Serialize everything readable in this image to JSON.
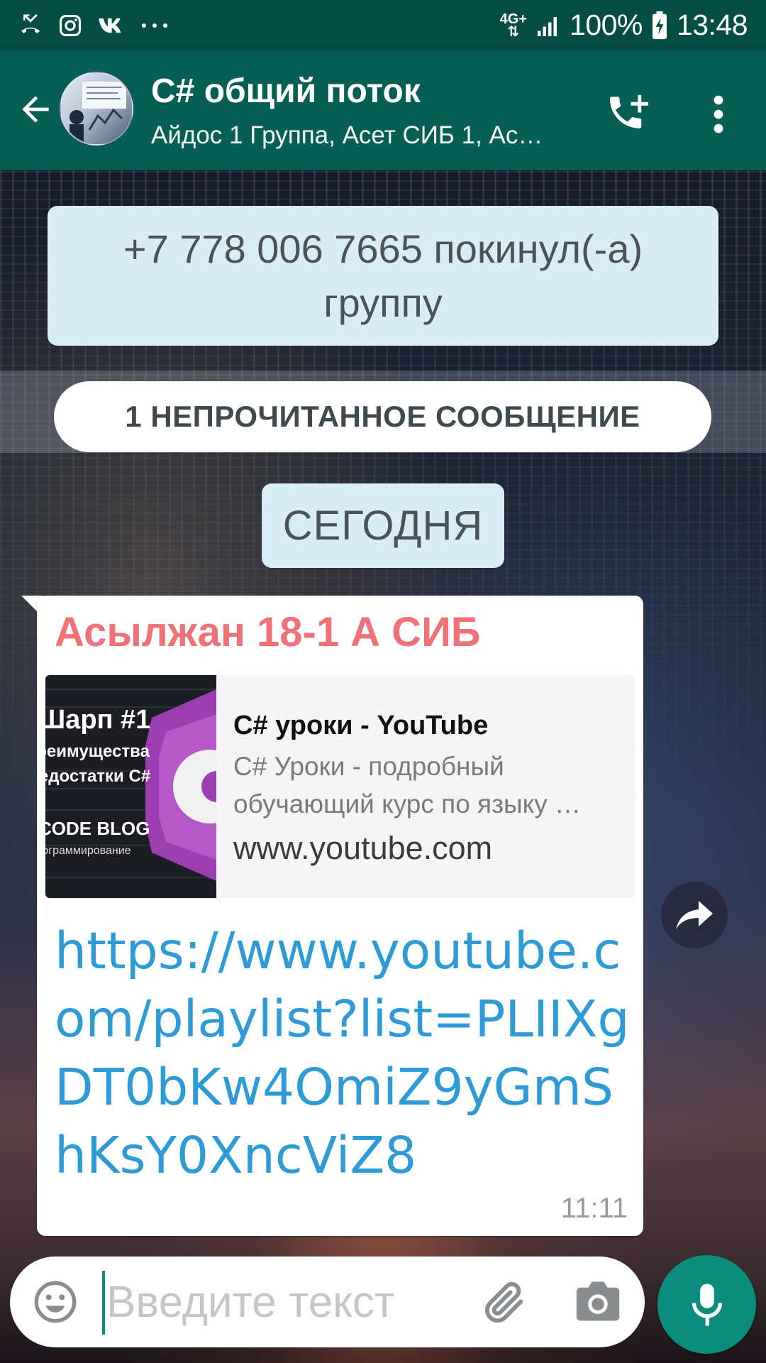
{
  "status_bar": {
    "network_top": "4G+",
    "battery": "100%",
    "time": "13:48",
    "left_icons": [
      "missed-call-icon",
      "instagram-icon",
      "vk-icon",
      "more-dots-icon"
    ]
  },
  "header": {
    "title": "C# общий поток",
    "subtitle": "Айдос 1 Группа, Асет СИБ 1, Ас…",
    "color": "#075e54"
  },
  "chat": {
    "system_message": "+7 778 006 7665 покинул(-а) группу",
    "unread_banner": "1 НЕПРОЧИТАННОЕ СООБЩЕНИЕ",
    "date_chip": "СЕГОДНЯ",
    "message": {
      "sender": "Асылжан 18-1 А СИБ",
      "sender_color": "#f07178",
      "preview": {
        "thumb_lines": [
          "Шарп #1",
          "Преимущества",
          "и недостатки C#",
          "CODE BLOG",
          "Программирование"
        ],
        "title": "C# уроки - YouTube",
        "description_line1": "C# Уроки - подробный",
        "description_line2": "обучающий курс по языку …",
        "domain": "www.youtube.com"
      },
      "link": "https://www.youtube.com/playlist?list=PLIIXgDT0bKw4OmiZ9yGmShKsY0XncViZ8",
      "time": "11:11"
    }
  },
  "input": {
    "placeholder": "Введите текст"
  },
  "accent_color": "#0b8d7c"
}
